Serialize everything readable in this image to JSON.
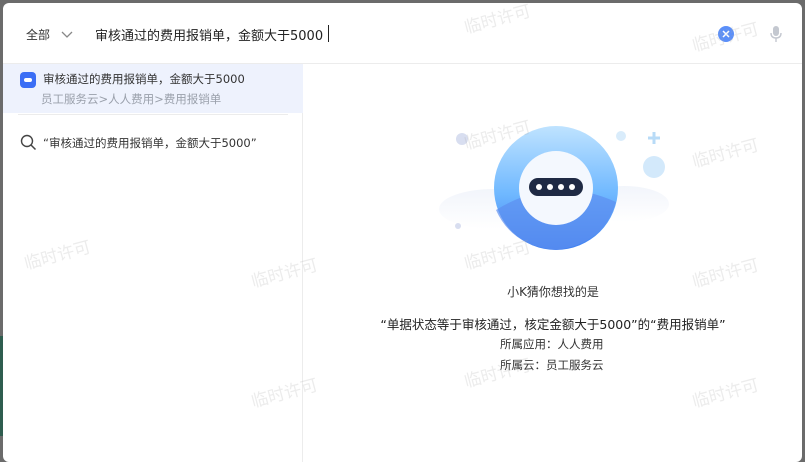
{
  "search": {
    "scope_label": "全部",
    "query": "审核通过的费用报销单，金额大于5000"
  },
  "suggestion": {
    "title": "审核通过的费用报销单，金额大于5000",
    "path": "员工服务云>人人费用>费用报销单"
  },
  "query_item": {
    "text": "“审核通过的费用报销单，金额大于5000”"
  },
  "answer": {
    "guess_label": "小K猜你想找的是",
    "main_text": "“单据状态等于审核通过，核定金额大于5000”的“费用报销单”",
    "app_line": "所属应用：人人费用",
    "cloud_line": "所属云：员工服务云"
  },
  "watermark_text": "临时许可",
  "colors": {
    "accent": "#3b6ef5",
    "selected_bg": "#eef2fd",
    "muted_text": "#9aa0ab"
  },
  "icons": [
    "chevron-down-icon",
    "clear-icon",
    "microphone-icon",
    "app-icon",
    "search-icon",
    "robot-illustration"
  ]
}
